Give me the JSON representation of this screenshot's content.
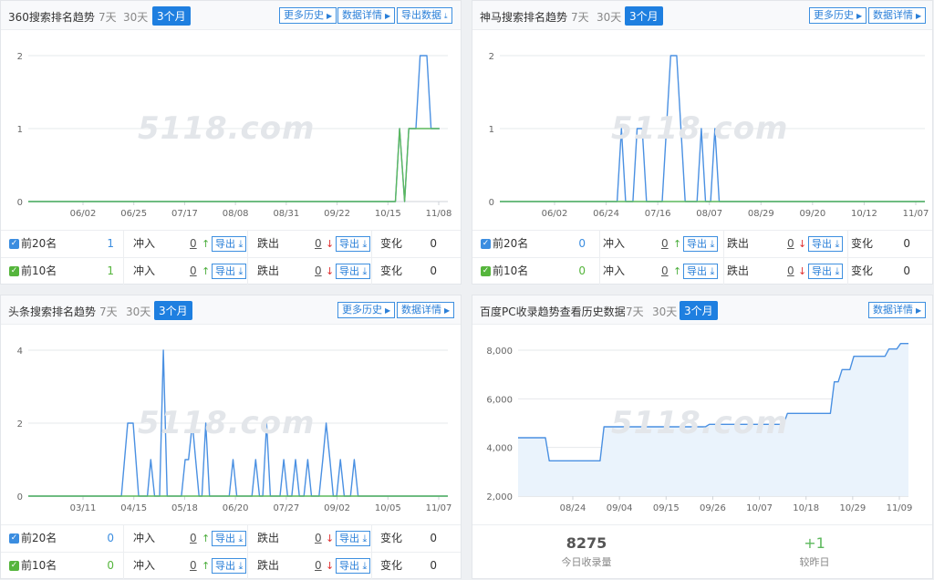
{
  "colors": {
    "blue": "#4a90e2",
    "green": "#5cb85c",
    "accent": "#1e7fe0",
    "area": "#eaf3fc"
  },
  "watermark": "5118.com",
  "export_label": "导出",
  "panels": {
    "p360": {
      "title": "360搜索排名趋势",
      "ranges": [
        "7天",
        "30天",
        "3个月"
      ],
      "buttons": [
        "更多历史",
        "数据详情",
        "导出数据"
      ],
      "rows": [
        {
          "label": "前20名",
          "value": "1",
          "chong": "冲入",
          "chong_val": "0",
          "die": "跌出",
          "die_val": "0",
          "bian": "变化",
          "bian_val": "0"
        },
        {
          "label": "前10名",
          "value": "1",
          "chong": "冲入",
          "chong_val": "0",
          "die": "跌出",
          "die_val": "0",
          "bian": "变化",
          "bian_val": "0"
        }
      ]
    },
    "shenma": {
      "title": "神马搜索排名趋势",
      "ranges": [
        "7天",
        "30天",
        "3个月"
      ],
      "buttons": [
        "更多历史",
        "数据详情"
      ],
      "rows": [
        {
          "label": "前20名",
          "value": "0",
          "chong": "冲入",
          "chong_val": "0",
          "die": "跌出",
          "die_val": "0",
          "bian": "变化",
          "bian_val": "0"
        },
        {
          "label": "前10名",
          "value": "0",
          "chong": "冲入",
          "chong_val": "0",
          "die": "跌出",
          "die_val": "0",
          "bian": "变化",
          "bian_val": "0"
        }
      ]
    },
    "toutiao": {
      "title": "头条搜索排名趋势",
      "ranges": [
        "7天",
        "30天",
        "3个月"
      ],
      "buttons": [
        "更多历史",
        "数据详情"
      ],
      "rows": [
        {
          "label": "前20名",
          "value": "0",
          "chong": "冲入",
          "chong_val": "0",
          "die": "跌出",
          "die_val": "0",
          "bian": "变化",
          "bian_val": "0"
        },
        {
          "label": "前10名",
          "value": "0",
          "chong": "冲入",
          "chong_val": "0",
          "die": "跌出",
          "die_val": "0",
          "bian": "变化",
          "bian_val": "0"
        }
      ]
    },
    "baidu": {
      "title": "百度PC收录趋势查看历史数据",
      "ranges": [
        "7天",
        "30天",
        "3个月"
      ],
      "buttons": [
        "数据详情"
      ],
      "today_count": "8275",
      "today_label": "今日收录量",
      "change": "+1",
      "change_label": "较昨日"
    }
  },
  "chart_data": [
    {
      "type": "line",
      "title": "360搜索排名趋势",
      "xlabel": "",
      "ylabel": "",
      "ylim": [
        0,
        2
      ],
      "y_ticks": [
        "0",
        "1",
        "2"
      ],
      "x_ticks": [
        "06/02",
        "06/25",
        "07/17",
        "08/08",
        "08/31",
        "09/22",
        "10/15",
        "11/08"
      ],
      "x_range": [
        0,
        100
      ],
      "grid": true,
      "series": [
        {
          "name": "前20名",
          "color": "blue",
          "points": [
            [
              0,
              0
            ],
            [
              87.5,
              0
            ],
            [
              88.5,
              1
            ],
            [
              89.7,
              0
            ],
            [
              90.7,
              1
            ],
            [
              92.4,
              1
            ],
            [
              93.4,
              2
            ],
            [
              95,
              2
            ],
            [
              96,
              1
            ],
            [
              98,
              1
            ]
          ]
        },
        {
          "name": "前10名",
          "color": "green",
          "points": [
            [
              0,
              0
            ],
            [
              87.5,
              0
            ],
            [
              88.5,
              1
            ],
            [
              89.7,
              0
            ],
            [
              90.7,
              1
            ],
            [
              98,
              1
            ]
          ]
        }
      ]
    },
    {
      "type": "line",
      "title": "神马搜索排名趋势",
      "xlabel": "",
      "ylabel": "",
      "ylim": [
        0,
        2
      ],
      "y_ticks": [
        "0",
        "1",
        "2"
      ],
      "x_ticks": [
        "06/02",
        "06/24",
        "07/16",
        "08/07",
        "08/29",
        "09/20",
        "10/12",
        "11/07"
      ],
      "x_range": [
        0,
        100
      ],
      "grid": true,
      "series": [
        {
          "name": "前20名",
          "color": "blue",
          "points": [
            [
              0,
              0
            ],
            [
              27.6,
              0
            ],
            [
              28.6,
              1
            ],
            [
              29.6,
              0
            ],
            [
              31.3,
              0
            ],
            [
              32.3,
              1
            ],
            [
              33.5,
              1
            ],
            [
              34.5,
              0
            ],
            [
              38.2,
              0
            ],
            [
              40.2,
              2
            ],
            [
              41.6,
              2
            ],
            [
              43.6,
              0
            ],
            [
              46.4,
              0
            ],
            [
              47.4,
              1
            ],
            [
              48.4,
              0
            ],
            [
              49.6,
              0
            ],
            [
              50.6,
              1
            ],
            [
              51.6,
              0
            ],
            [
              100,
              0
            ]
          ]
        },
        {
          "name": "前10名",
          "color": "green",
          "points": [
            [
              0,
              0
            ],
            [
              100,
              0
            ]
          ]
        }
      ]
    },
    {
      "type": "line",
      "title": "头条搜索排名趋势",
      "xlabel": "",
      "ylabel": "",
      "ylim": [
        0,
        4
      ],
      "y_ticks": [
        "0",
        "2",
        "4"
      ],
      "x_ticks": [
        "03/11",
        "04/15",
        "05/18",
        "06/20",
        "07/27",
        "09/02",
        "10/05",
        "11/07"
      ],
      "x_range": [
        0,
        100
      ],
      "grid": true,
      "series": [
        {
          "name": "前20名",
          "color": "blue",
          "points": [
            [
              0,
              0
            ],
            [
              22.2,
              0
            ],
            [
              23.7,
              2
            ],
            [
              25,
              2
            ],
            [
              26.3,
              0
            ],
            [
              28.4,
              0
            ],
            [
              29.2,
              1
            ],
            [
              30.1,
              0
            ],
            [
              31.3,
              0
            ],
            [
              32.2,
              4
            ],
            [
              33.1,
              0
            ],
            [
              36.5,
              0
            ],
            [
              37.4,
              1
            ],
            [
              38.2,
              1
            ],
            [
              39.1,
              2
            ],
            [
              39.9,
              1
            ],
            [
              40.7,
              0
            ],
            [
              41.4,
              0
            ],
            [
              42.3,
              2
            ],
            [
              43.2,
              0
            ],
            [
              47.9,
              0
            ],
            [
              48.8,
              1
            ],
            [
              49.7,
              0
            ],
            [
              53.3,
              0
            ],
            [
              54.2,
              1
            ],
            [
              55.1,
              0
            ],
            [
              55.9,
              0
            ],
            [
              56.8,
              2
            ],
            [
              57.7,
              0
            ],
            [
              60,
              0
            ],
            [
              60.9,
              1
            ],
            [
              61.8,
              0
            ],
            [
              62.8,
              0
            ],
            [
              63.7,
              1
            ],
            [
              64.6,
              0
            ],
            [
              65.7,
              0
            ],
            [
              66.6,
              1
            ],
            [
              67.5,
              0
            ],
            [
              69.3,
              0
            ],
            [
              70.2,
              1
            ],
            [
              71,
              2
            ],
            [
              71.9,
              1
            ],
            [
              72.7,
              0
            ],
            [
              73.5,
              0
            ],
            [
              74.4,
              1
            ],
            [
              75.3,
              0
            ],
            [
              76.8,
              0
            ],
            [
              77.7,
              1
            ],
            [
              78.6,
              0
            ],
            [
              100,
              0
            ]
          ]
        },
        {
          "name": "前10名",
          "color": "green",
          "points": [
            [
              0,
              0
            ],
            [
              100,
              0
            ]
          ]
        }
      ]
    },
    {
      "type": "area",
      "title": "百度PC收录趋势查看历史数据",
      "xlabel": "",
      "ylabel": "",
      "ylim": [
        2000,
        8300
      ],
      "y_ticks": [
        "2,000",
        "4,000",
        "6,000",
        "8,000"
      ],
      "x_ticks": [
        "08/24",
        "09/04",
        "09/15",
        "09/26",
        "10/07",
        "10/18",
        "10/29",
        "11/09"
      ],
      "x_range": [
        0,
        100
      ],
      "grid": true,
      "series": [
        {
          "name": "",
          "color": "blue",
          "points": [
            [
              0,
              4400
            ],
            [
              7,
              4400
            ],
            [
              8,
              3450
            ],
            [
              21,
              3450
            ],
            [
              22,
              4850
            ],
            [
              48,
              4850
            ],
            [
              49,
              4950
            ],
            [
              68,
              4950
            ],
            [
              69,
              5400
            ],
            [
              80,
              5400
            ],
            [
              81,
              6700
            ],
            [
              82,
              6700
            ],
            [
              83,
              7200
            ],
            [
              85,
              7200
            ],
            [
              86,
              7750
            ],
            [
              94,
              7750
            ],
            [
              95,
              8050
            ],
            [
              97,
              8050
            ],
            [
              98,
              8275
            ],
            [
              100,
              8275
            ]
          ]
        }
      ]
    }
  ]
}
